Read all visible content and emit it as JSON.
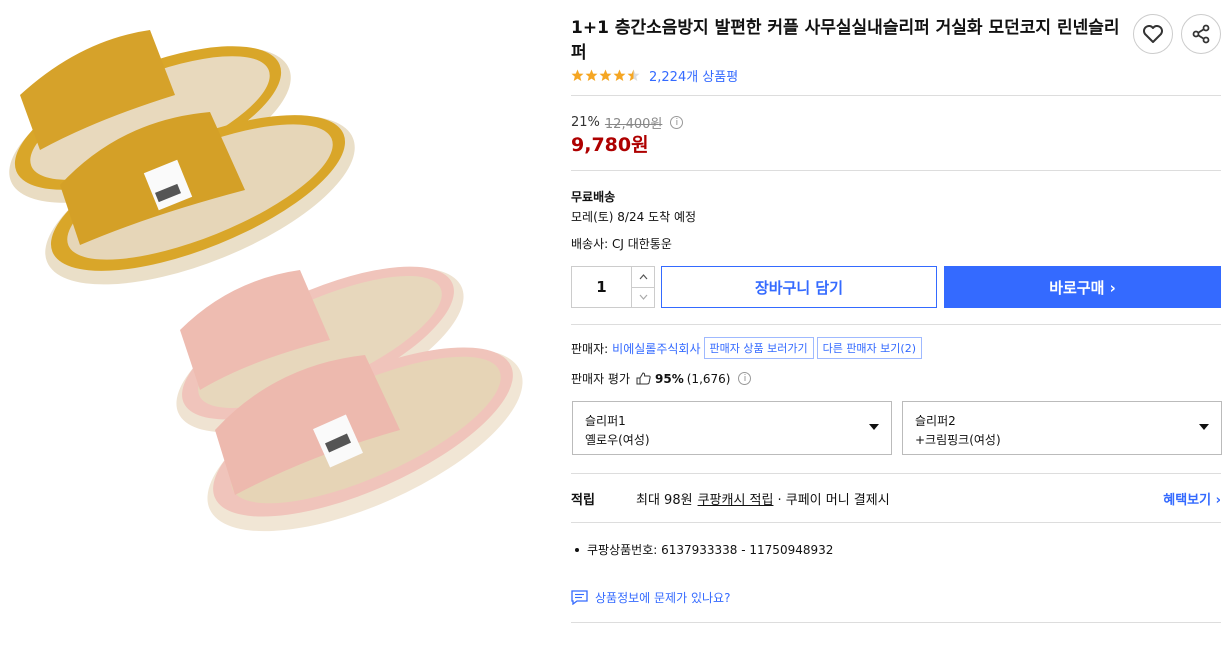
{
  "product": {
    "title": "1+1 층간소음방지 발편한 커플 사무실실내슬리퍼 거실화 모던코지 린넨슬리퍼",
    "rating": 4.5,
    "review_count": "2,224개 상품평"
  },
  "price": {
    "discount_rate": "21%",
    "original_price": "12,400원",
    "info_icon": "ⓘ",
    "sale_price": "9,780원"
  },
  "shipping": {
    "free_label": "무료배송",
    "arrival": "모레(토) 8/24 도착 예정",
    "carrier": "배송사: CJ 대한통운"
  },
  "purchase": {
    "quantity": "1",
    "cart_label": "장바구니 담기",
    "buy_label": "바로구매 ›"
  },
  "seller": {
    "label": "판매자:",
    "name": "비에실롤주식회사",
    "view_products": "판매자 상품 보러가기",
    "other_sellers": "다른 판매자 보기(2)",
    "rating_label": "판매자 평가",
    "rating_pct": "95%",
    "rating_count": "(1,676)"
  },
  "options": [
    {
      "label": "슬리퍼1",
      "value": "옐로우(여성)"
    },
    {
      "label": "슬리퍼2",
      "value": "+크림핑크(여성)"
    }
  ],
  "reward": {
    "label": "적립",
    "text_prefix": "최대 98원",
    "link": "쿠팡캐시 적립",
    "text_suffix": "· 쿠페이 머니 결제시",
    "benefit_link": "혜택보기 ›"
  },
  "product_id": "쿠팡상품번호: 6137933338 - 11750948932",
  "report_link": "상품정보에 문제가 있나요?",
  "colors": {
    "accent": "#346aff",
    "sale": "#ae0000",
    "star": "#f5a623",
    "yellow_slipper": "#d9a629",
    "pink_slipper": "#f0c4bb"
  }
}
